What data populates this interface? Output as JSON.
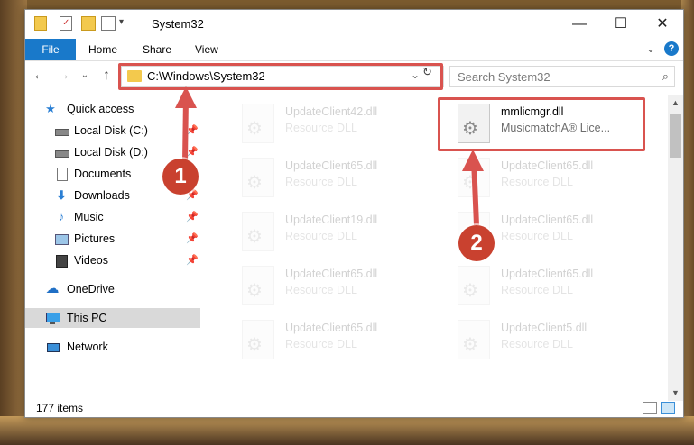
{
  "window": {
    "title": "System32",
    "minimize": "—",
    "maximize": "☐",
    "close": "✕"
  },
  "ribbon": {
    "tabs": [
      "File",
      "Home",
      "Share",
      "View"
    ],
    "help": "?"
  },
  "nav": {
    "address": "C:\\Windows\\System32",
    "search_placeholder": "Search System32"
  },
  "sidebar": {
    "items": [
      {
        "label": "Quick access",
        "icon": "star-icon",
        "pinned": false
      },
      {
        "label": "Local Disk (C:)",
        "icon": "drive-icon",
        "pinned": true
      },
      {
        "label": "Local Disk (D:)",
        "icon": "drive-icon",
        "pinned": true
      },
      {
        "label": "Documents",
        "icon": "documents-icon",
        "pinned": true
      },
      {
        "label": "Downloads",
        "icon": "download-icon",
        "pinned": true
      },
      {
        "label": "Music",
        "icon": "music-icon",
        "pinned": true
      },
      {
        "label": "Pictures",
        "icon": "pictures-icon",
        "pinned": true
      },
      {
        "label": "Videos",
        "icon": "videos-icon",
        "pinned": true
      },
      {
        "label": "OneDrive",
        "icon": "cloud-icon",
        "pinned": false
      },
      {
        "label": "This PC",
        "icon": "computer-icon",
        "pinned": false,
        "selected": true
      },
      {
        "label": "Network",
        "icon": "network-icon",
        "pinned": false
      }
    ]
  },
  "files": [
    {
      "name": "UpdateClient42.dll",
      "type": "Resource DLL",
      "highlighted": false
    },
    {
      "name": "mmlicmgr.dll",
      "type": "MusicmatchA® Lice...",
      "highlighted": true
    },
    {
      "name": "UpdateClient65.dll",
      "type": "Resource DLL",
      "highlighted": false
    },
    {
      "name": "UpdateClient65.dll",
      "type": "Resource DLL",
      "highlighted": false
    },
    {
      "name": "UpdateClient19.dll",
      "type": "Resource DLL",
      "highlighted": false
    },
    {
      "name": "UpdateClient65.dll",
      "type": "Resource DLL",
      "highlighted": false
    },
    {
      "name": "UpdateClient65.dll",
      "type": "Resource DLL",
      "highlighted": false
    },
    {
      "name": "UpdateClient65.dll",
      "type": "Resource DLL",
      "highlighted": false
    },
    {
      "name": "UpdateClient65.dll",
      "type": "Resource DLL",
      "highlighted": false
    },
    {
      "name": "UpdateClient5.dll",
      "type": "Resource DLL",
      "highlighted": false
    }
  ],
  "status": {
    "item_count": "177 items"
  },
  "annotations": {
    "step1": "1",
    "step2": "2",
    "color": "#d9534f"
  }
}
